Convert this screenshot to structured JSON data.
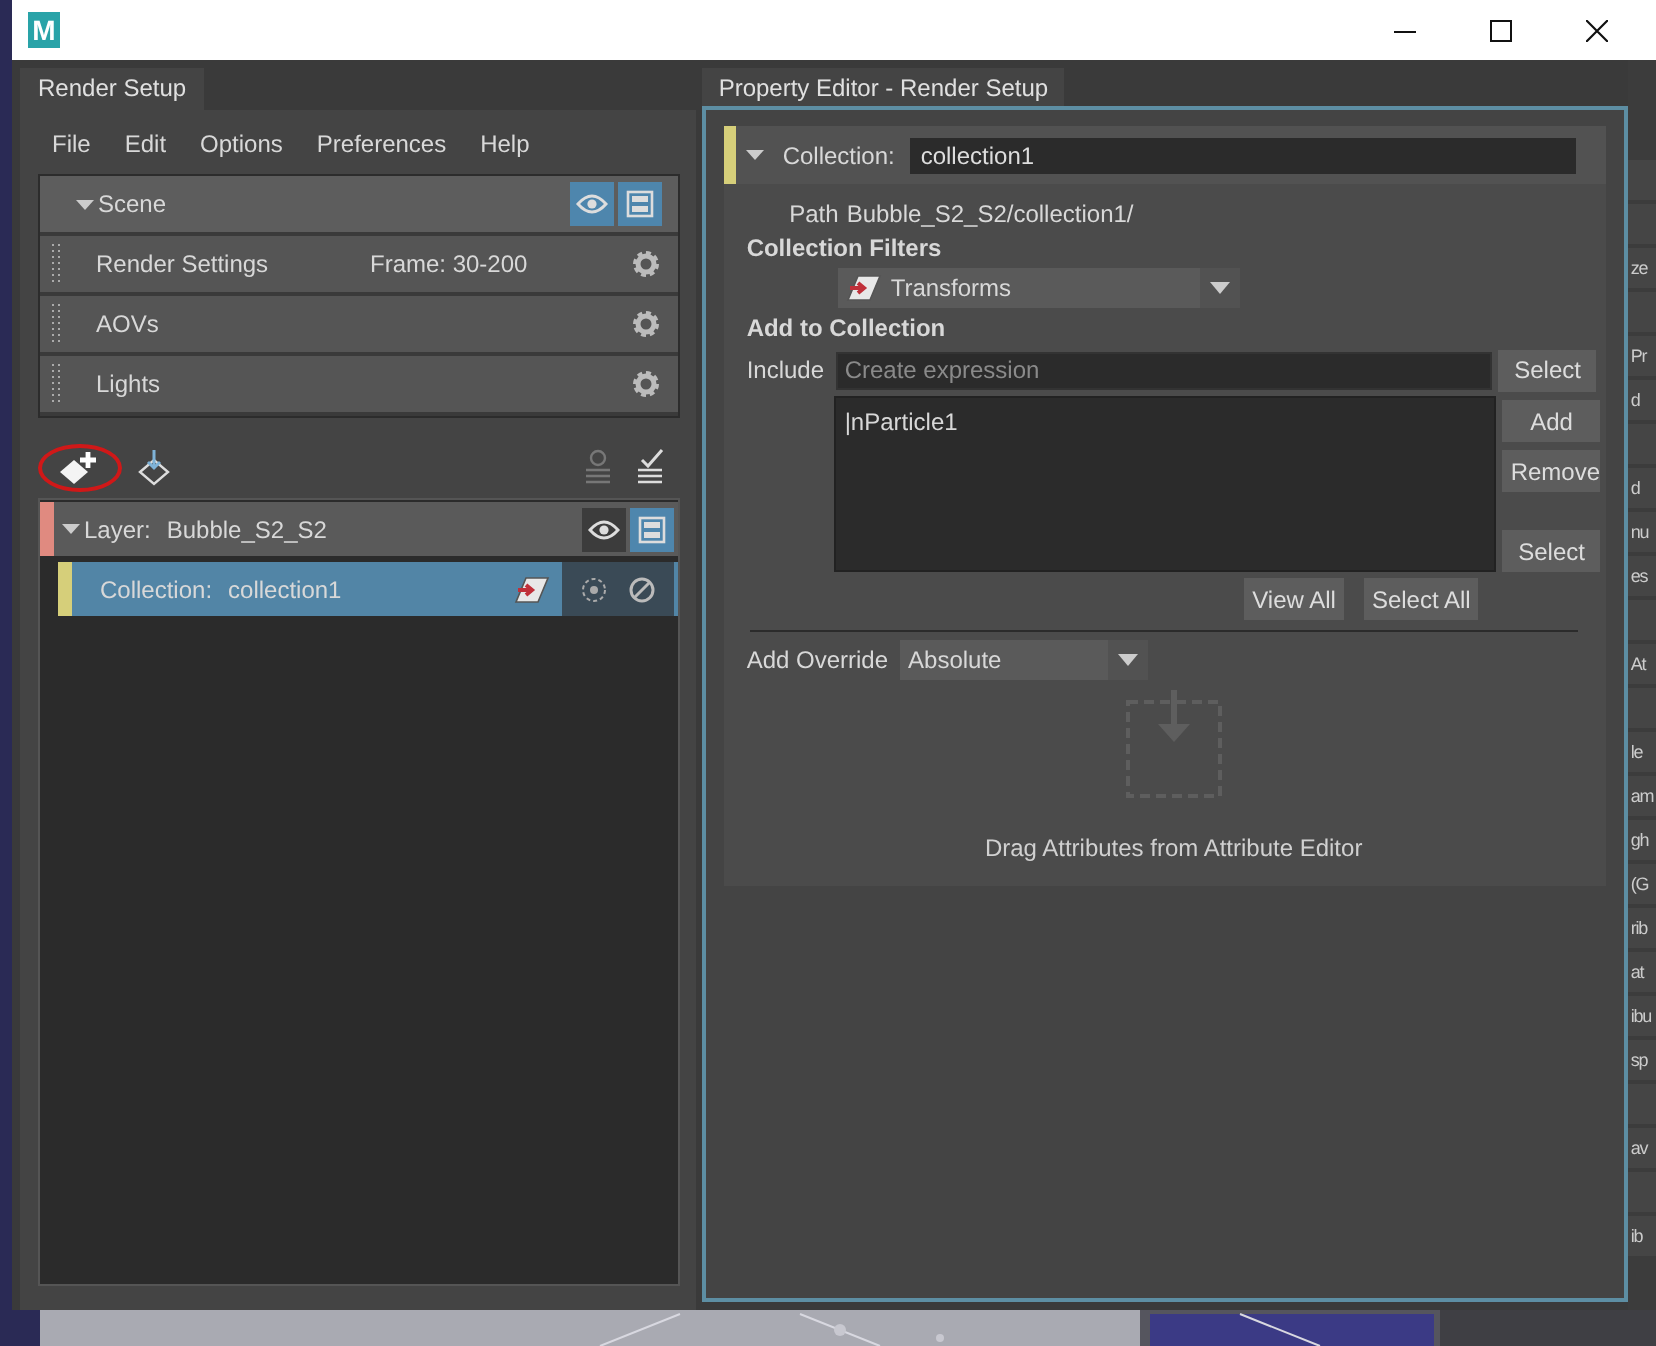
{
  "title_bar": {
    "app_icon": "M"
  },
  "render_setup": {
    "tab": "Render Setup",
    "menu": [
      "File",
      "Edit",
      "Options",
      "Preferences",
      "Help"
    ],
    "scene": {
      "label": "Scene",
      "expanded": true,
      "visible": true,
      "renderable": true
    },
    "scene_items": [
      {
        "label": "Render Settings",
        "detail": "Frame: 30-200"
      },
      {
        "label": "AOVs"
      },
      {
        "label": "Lights"
      }
    ],
    "tree": [
      {
        "kind": "layer",
        "label": "Layer:",
        "name": "Bubble_S2_S2",
        "expanded": true,
        "selected": false,
        "color": "#e08a80",
        "visible": false,
        "renderable": true
      },
      {
        "kind": "collection",
        "label": "Collection:",
        "name": "collection1",
        "selected": true,
        "color": "#d6cf7a"
      }
    ]
  },
  "property_editor": {
    "tab": "Property Editor - Render Setup",
    "header": {
      "label": "Collection:",
      "value": "collection1",
      "expanded": true,
      "color": "#d6cf7a"
    },
    "path_label": "Path",
    "path": "Bubble_S2_S2/collection1/",
    "filters_heading": "Collection Filters",
    "filter": "Transforms",
    "add_heading": "Add to Collection",
    "include_label": "Include",
    "include_placeholder": "Create expression",
    "include_button": "Select",
    "members": [
      "|nParticle1"
    ],
    "list_buttons": [
      "Add",
      "Remove"
    ],
    "select_button": "Select",
    "bottom_buttons": [
      "View All",
      "Select All"
    ],
    "override_label": "Add Override",
    "override_mode": "Absolute",
    "drop_hint": "Drag Attributes from Attribute Editor"
  },
  "behind_panel": {
    "rows": [
      {
        "kind": "blank"
      },
      {
        "kind": "blank"
      },
      {
        "kind": "text",
        "text": "ze"
      },
      {
        "kind": "blank"
      },
      {
        "kind": "text",
        "text": "Pr"
      },
      {
        "kind": "text",
        "text": "d"
      },
      {
        "kind": "blank"
      },
      {
        "kind": "text",
        "text": "d"
      },
      {
        "kind": "text",
        "text": "nu"
      },
      {
        "kind": "text",
        "text": "es"
      },
      {
        "kind": "blank"
      },
      {
        "kind": "text",
        "text": "At"
      },
      {
        "kind": "blank"
      },
      {
        "kind": "text",
        "text": "le"
      },
      {
        "kind": "text",
        "text": "am"
      },
      {
        "kind": "text",
        "text": "gh"
      },
      {
        "kind": "text",
        "text": "(G"
      },
      {
        "kind": "text",
        "text": "rib"
      },
      {
        "kind": "text",
        "text": "at"
      },
      {
        "kind": "text",
        "text": "ibu"
      },
      {
        "kind": "text",
        "text": "sp"
      },
      {
        "kind": "blank"
      },
      {
        "kind": "text",
        "text": "av"
      },
      {
        "kind": "blank"
      },
      {
        "kind": "text",
        "text": "ib"
      }
    ]
  }
}
